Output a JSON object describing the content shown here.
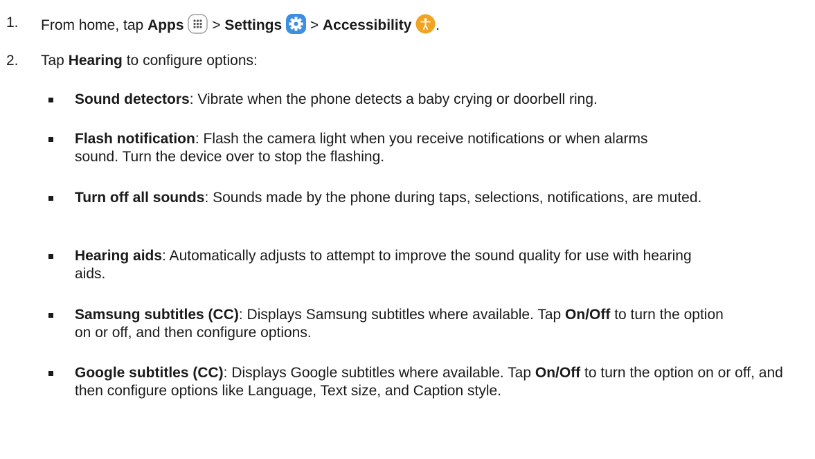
{
  "step1": {
    "number": "1.",
    "prefix": "From home, tap ",
    "apps": "Apps",
    "sep1": " > ",
    "settings": "Settings",
    "sep2": " > ",
    "accessibility": "Accessibility",
    "end": "."
  },
  "step2": {
    "number": "2.",
    "prefix": "Tap ",
    "hearing": "Hearing",
    "suffix": " to configure options:"
  },
  "bullets": [
    {
      "title": "Sound detectors",
      "text": ": Vibrate when the phone detects a baby crying or doorbell ring."
    },
    {
      "title": "Flash notification",
      "text": ": Flash the camera light when you receive notifications or when alarms sound. Turn the device over to stop the flashing."
    },
    {
      "title": "Turn off all sounds",
      "text": ": Sounds made by the phone during taps, selections, notifications, are muted."
    },
    {
      "title": "Hearing aids",
      "text": ": Automatically adjusts to attempt to improve the sound quality for use with hearing aids."
    },
    {
      "title": "Samsung subtitles (CC)",
      "text1": ": Displays Samsung subtitles where available. Tap ",
      "bold2": "On/Off",
      "text2": " to turn the option on or off, and then configure options."
    },
    {
      "title": "Google subtitles (CC)",
      "text1": ": Displays Google subtitles where available. Tap ",
      "bold2": "On/Off",
      "text2": " to turn the option on or off, and then configure options like Language, Text size, and Caption style."
    }
  ],
  "icons": {
    "apps": "apps-grid-icon",
    "settings": "settings-gear-icon",
    "accessibility": "accessibility-person-icon"
  },
  "colors": {
    "settings_blue": "#3f8fe0",
    "accessibility_orange": "#f0a422"
  }
}
